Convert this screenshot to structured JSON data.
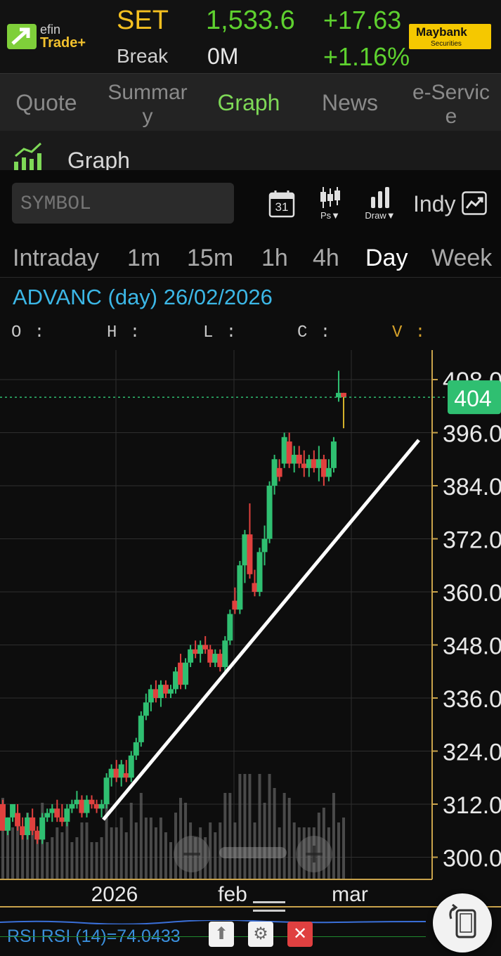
{
  "header": {
    "logo_line1": "efin",
    "logo_line2": "Trade+",
    "index_name": "SET",
    "index_value": "1,533.6",
    "change": "+17.63",
    "change_pct": "+1.16%",
    "break_label": "Break",
    "volume": "0M",
    "broker_name": "Maybank",
    "broker_sub": "Securities"
  },
  "tabs": [
    "Quote",
    "Summar\ny",
    "Graph",
    "News",
    "e-Servic\ne"
  ],
  "active_tab": "Graph",
  "section_title": "Graph",
  "toolbar": {
    "symbol_placeholder": "SYMBOL",
    "calendar_day": "31",
    "ps_label": "Ps▼",
    "draw_label": "Draw▼",
    "indy_label": "Indy"
  },
  "timeframes": [
    "Intraday",
    "1m",
    "15m",
    "1h",
    "4h",
    "Day",
    "Week"
  ],
  "active_timeframe": "Day",
  "chart_header": {
    "title": "ADVANC (day) 26/02/2026",
    "o_label": "O :",
    "h_label": "H :",
    "l_label": "L :",
    "c_label": "C :",
    "v_label": "V :"
  },
  "chart_data": {
    "type": "candlestick",
    "symbol": "ADVANC",
    "interval": "day",
    "y_ticks": [
      "408.0",
      "396.0",
      "384.0",
      "372.0",
      "360.0",
      "348.0",
      "336.0",
      "324.0",
      "312.0",
      "300.0"
    ],
    "x_ticks": [
      "2026",
      "feb",
      "mar"
    ],
    "current_price": "404",
    "ylim": [
      296,
      410
    ],
    "grid": true,
    "candles": [
      {
        "o": 312,
        "h": 313,
        "l": 306,
        "c": 306
      },
      {
        "o": 306,
        "h": 309,
        "l": 305,
        "c": 309
      },
      {
        "o": 309,
        "h": 312,
        "l": 308,
        "c": 312
      },
      {
        "o": 310,
        "h": 312,
        "l": 306,
        "c": 307
      },
      {
        "o": 307,
        "h": 309,
        "l": 304,
        "c": 305
      },
      {
        "o": 305,
        "h": 310,
        "l": 304,
        "c": 309
      },
      {
        "o": 309,
        "h": 311,
        "l": 305,
        "c": 306
      },
      {
        "o": 306,
        "h": 307,
        "l": 303,
        "c": 304
      },
      {
        "o": 304,
        "h": 310,
        "l": 303,
        "c": 309
      },
      {
        "o": 309,
        "h": 311,
        "l": 308,
        "c": 310
      },
      {
        "o": 310,
        "h": 312,
        "l": 308,
        "c": 311
      },
      {
        "o": 311,
        "h": 313,
        "l": 308,
        "c": 309
      },
      {
        "o": 309,
        "h": 312,
        "l": 307,
        "c": 308
      },
      {
        "o": 308,
        "h": 312,
        "l": 307,
        "c": 311
      },
      {
        "o": 311,
        "h": 313,
        "l": 310,
        "c": 312
      },
      {
        "o": 312,
        "h": 315,
        "l": 311,
        "c": 313
      },
      {
        "o": 313,
        "h": 314,
        "l": 309,
        "c": 310
      },
      {
        "o": 310,
        "h": 314,
        "l": 309,
        "c": 313
      },
      {
        "o": 313,
        "h": 314,
        "l": 311,
        "c": 312
      },
      {
        "o": 312,
        "h": 313,
        "l": 310,
        "c": 311
      },
      {
        "o": 311,
        "h": 313,
        "l": 309,
        "c": 312
      },
      {
        "o": 312,
        "h": 319,
        "l": 311,
        "c": 318
      },
      {
        "o": 318,
        "h": 321,
        "l": 316,
        "c": 320
      },
      {
        "o": 320,
        "h": 322,
        "l": 317,
        "c": 318
      },
      {
        "o": 318,
        "h": 322,
        "l": 316,
        "c": 321
      },
      {
        "o": 319,
        "h": 322,
        "l": 317,
        "c": 318
      },
      {
        "o": 318,
        "h": 324,
        "l": 317,
        "c": 323
      },
      {
        "o": 323,
        "h": 327,
        "l": 322,
        "c": 326
      },
      {
        "o": 326,
        "h": 333,
        "l": 325,
        "c": 332
      },
      {
        "o": 332,
        "h": 337,
        "l": 331,
        "c": 335
      },
      {
        "o": 335,
        "h": 339,
        "l": 333,
        "c": 338
      },
      {
        "o": 338,
        "h": 340,
        "l": 335,
        "c": 336
      },
      {
        "o": 336,
        "h": 340,
        "l": 334,
        "c": 339
      },
      {
        "o": 339,
        "h": 340,
        "l": 336,
        "c": 337
      },
      {
        "o": 337,
        "h": 339,
        "l": 336,
        "c": 338
      },
      {
        "o": 338,
        "h": 343,
        "l": 337,
        "c": 342
      },
      {
        "o": 344,
        "h": 346,
        "l": 338,
        "c": 339
      },
      {
        "o": 339,
        "h": 345,
        "l": 338,
        "c": 344
      },
      {
        "o": 344,
        "h": 348,
        "l": 343,
        "c": 347
      },
      {
        "o": 347,
        "h": 349,
        "l": 345,
        "c": 346
      },
      {
        "o": 346,
        "h": 349,
        "l": 344,
        "c": 348
      },
      {
        "o": 348,
        "h": 350,
        "l": 346,
        "c": 347
      },
      {
        "o": 347,
        "h": 348,
        "l": 343,
        "c": 344
      },
      {
        "o": 344,
        "h": 347,
        "l": 343,
        "c": 346
      },
      {
        "o": 346,
        "h": 347,
        "l": 342,
        "c": 343
      },
      {
        "o": 343,
        "h": 350,
        "l": 342,
        "c": 349
      },
      {
        "o": 349,
        "h": 356,
        "l": 348,
        "c": 355
      },
      {
        "o": 358,
        "h": 361,
        "l": 355,
        "c": 356
      },
      {
        "o": 356,
        "h": 367,
        "l": 355,
        "c": 366
      },
      {
        "o": 366,
        "h": 374,
        "l": 362,
        "c": 373
      },
      {
        "o": 373,
        "h": 380,
        "l": 363,
        "c": 364
      },
      {
        "o": 362,
        "h": 365,
        "l": 359,
        "c": 360
      },
      {
        "o": 360,
        "h": 370,
        "l": 359,
        "c": 369
      },
      {
        "o": 369,
        "h": 375,
        "l": 366,
        "c": 372
      },
      {
        "o": 372,
        "h": 385,
        "l": 371,
        "c": 384
      },
      {
        "o": 384,
        "h": 391,
        "l": 382,
        "c": 390
      },
      {
        "o": 388,
        "h": 390,
        "l": 385,
        "c": 386
      },
      {
        "o": 389,
        "h": 396,
        "l": 388,
        "c": 395
      },
      {
        "o": 394,
        "h": 396,
        "l": 388,
        "c": 389
      },
      {
        "o": 389,
        "h": 393,
        "l": 387,
        "c": 391
      },
      {
        "o": 391,
        "h": 393,
        "l": 388,
        "c": 389
      },
      {
        "o": 389,
        "h": 392,
        "l": 386,
        "c": 388
      },
      {
        "o": 388,
        "h": 391,
        "l": 386,
        "c": 390
      },
      {
        "o": 390,
        "h": 392,
        "l": 387,
        "c": 388
      },
      {
        "o": 388,
        "h": 393,
        "l": 385,
        "c": 390
      },
      {
        "o": 390,
        "h": 391,
        "l": 384,
        "c": 386
      },
      {
        "o": 386,
        "h": 390,
        "l": 385,
        "c": 388
      },
      {
        "o": 388,
        "h": 395,
        "l": 387,
        "c": 394
      },
      {
        "o": 404,
        "h": 410,
        "l": 403,
        "c": 405
      },
      {
        "o": 405,
        "h": 405,
        "l": 397,
        "c": 404
      }
    ]
  },
  "rsi": {
    "label": "RSI RSI (14)=74.0433"
  },
  "colors": {
    "up": "#2fbf71",
    "down": "#e0413e",
    "doji": "#d4b12a",
    "accent_green": "#7ed957",
    "price_tag": "#2fbf71",
    "axis": "#c8a24b"
  }
}
